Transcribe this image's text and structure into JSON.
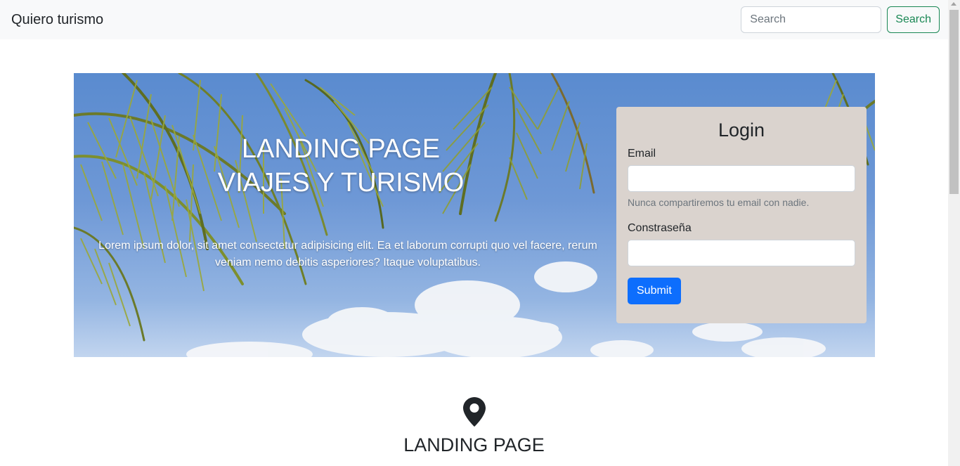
{
  "navbar": {
    "brand": "Quiero turismo",
    "search_placeholder": "Search",
    "search_button": "Search"
  },
  "hero": {
    "title_line1": "LANDING PAGE",
    "title_line2": "VIAJES Y TURISMO",
    "text": "Lorem ipsum dolor, sit amet consectetur adipisicing elit. Ea et laborum corrupti quo vel facere, rerum veniam nemo debitis asperiores? Itaque voluptatibus."
  },
  "login": {
    "title": "Login",
    "email_label": "Email",
    "email_help": "Nunca compartiremos tu email con nadie.",
    "password_label": "Constraseña",
    "submit_label": "Submit"
  },
  "feature": {
    "icon": "map-pin-icon",
    "title": "LANDING PAGE"
  },
  "colors": {
    "navbar_bg": "#f8f9fa",
    "success": "#198754",
    "primary": "#0d6efd",
    "login_card_bg": "#dad3ce"
  }
}
